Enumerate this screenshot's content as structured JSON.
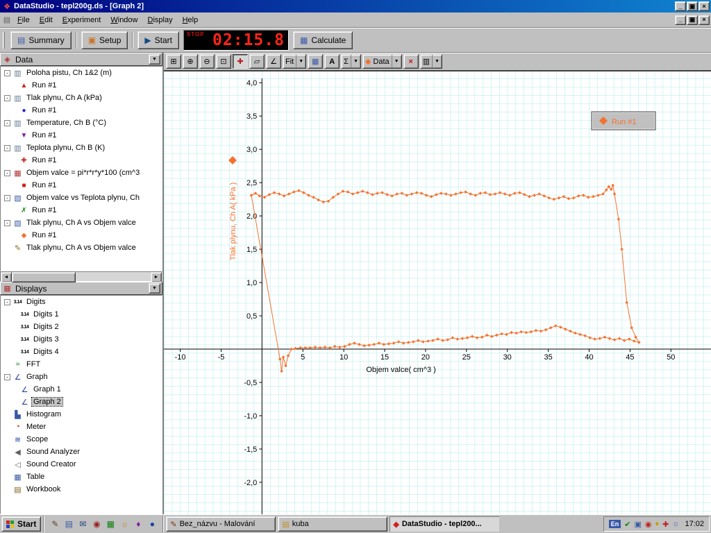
{
  "titlebar": {
    "title": "DataStudio - tepl200g.ds - [Graph 2]"
  },
  "menubar": {
    "items": [
      "File",
      "Edit",
      "Experiment",
      "Window",
      "Display",
      "Help"
    ]
  },
  "toolbar": {
    "summary_label": "Summary",
    "setup_label": "Setup",
    "start_label": "Start",
    "timer": {
      "stop_label": "STOP",
      "value": "02:15.8"
    },
    "calculate_label": "Calculate"
  },
  "graph_toolbar": {
    "buttons": [
      {
        "name": "scale-to-fit",
        "glyph": "⊞"
      },
      {
        "name": "zoom-in",
        "glyph": "⊕"
      },
      {
        "name": "zoom-out",
        "glyph": "⊖"
      },
      {
        "name": "zoom-select",
        "glyph": "⊡"
      },
      {
        "name": "smart-tool",
        "glyph": "✚",
        "color": "#b02020",
        "active": true
      },
      {
        "name": "slope-tool",
        "glyph": "▱"
      },
      {
        "name": "angle-tool",
        "glyph": "∠"
      },
      {
        "name": "fit-menu",
        "label": "Fit",
        "dropdown": true
      },
      {
        "name": "calculator-tool",
        "glyph": "▦",
        "color": "#3858a8"
      },
      {
        "name": "text-tool",
        "glyph": "A",
        "bold": true
      },
      {
        "name": "statistics-menu",
        "glyph": "Σ",
        "dropdown": true
      },
      {
        "name": "data-menu",
        "glyph": "◆",
        "color": "#f4722e",
        "label": "Data",
        "dropdown": true
      },
      {
        "name": "delete-button",
        "glyph": "×",
        "color": "#c01010",
        "bold": true
      },
      {
        "name": "graph-settings-menu",
        "glyph": "▥",
        "dropdown": true
      }
    ]
  },
  "sidebar": {
    "data_panel": {
      "title": "Data",
      "header_icon": "◈",
      "items": [
        {
          "label": "Poloha pistu, Ch 1&2 (m)",
          "glyph": "▥",
          "color": "#607890",
          "run": {
            "label": "Run #1",
            "marker": "▲",
            "marker_color": "#d02020"
          }
        },
        {
          "label": "Tlak plynu, Ch A (kPa)",
          "glyph": "▥",
          "color": "#607890",
          "run": {
            "label": "Run #1",
            "marker": "●",
            "marker_color": "#2020cc"
          }
        },
        {
          "label": "Temperature, Ch B (°C)",
          "glyph": "▥",
          "color": "#607890",
          "run": {
            "label": "Run #1",
            "marker": "▼",
            "marker_color": "#8020a0"
          }
        },
        {
          "label": "Teplota plynu, Ch B (K)",
          "glyph": "▥",
          "color": "#607890",
          "run": {
            "label": "Run #1",
            "marker": "✚",
            "marker_color": "#d02020"
          }
        },
        {
          "label": "Objem valce = pi*r*r*y*100 (cm^3",
          "glyph": "▦",
          "color": "#b03030",
          "run": {
            "label": "Run #1",
            "marker": "■",
            "marker_color": "#d02020"
          }
        },
        {
          "label": "Objem valce vs Teplota plynu, Ch",
          "glyph": "▧",
          "color": "#3858a8",
          "run": {
            "label": "Run #1",
            "marker": "✗",
            "marker_color": "#108010"
          }
        },
        {
          "label": "Tlak plynu, Ch A vs Objem valce",
          "glyph": "▧",
          "color": "#3858a8",
          "run": {
            "label": "Run #1",
            "marker": "◆",
            "marker_color": "#f4722e"
          }
        },
        {
          "label": "Tlak plynu, Ch A vs Objem valce",
          "glyph": "✎",
          "color": "#807020"
        }
      ]
    },
    "displays_panel": {
      "title": "Displays",
      "header_icon": "▦",
      "items": [
        {
          "label": "Digits",
          "glyph": "3.14",
          "small": true,
          "expand": true,
          "children": [
            {
              "label": "Digits 1",
              "glyph": "3.14",
              "small": true
            },
            {
              "label": "Digits 2",
              "glyph": "3.14",
              "small": true
            },
            {
              "label": "Digits 3",
              "glyph": "3.14",
              "small": true
            },
            {
              "label": "Digits 4",
              "glyph": "3.14",
              "small": true
            }
          ]
        },
        {
          "label": "FFT",
          "glyph": "≈",
          "color": "#108010"
        },
        {
          "label": "Graph",
          "glyph": "∠",
          "color": "#2040a0",
          "expand": true,
          "children": [
            {
              "label": "Graph 1",
              "glyph": "∠",
              "color": "#2040a0"
            },
            {
              "label": "Graph 2",
              "glyph": "∠",
              "color": "#2040a0",
              "selected": true
            }
          ]
        },
        {
          "label": "Histogram",
          "glyph": "▙",
          "color": "#3858a8"
        },
        {
          "label": "Meter",
          "glyph": "◔",
          "color": "#b02020"
        },
        {
          "label": "Scope",
          "glyph": "≋",
          "color": "#2040a0"
        },
        {
          "label": "Sound Analyzer",
          "glyph": "◀",
          "color": "#606060"
        },
        {
          "label": "Sound Creator",
          "glyph": "◁",
          "color": "#606060"
        },
        {
          "label": "Table",
          "glyph": "▦",
          "color": "#3858a8"
        },
        {
          "label": "Workbook",
          "glyph": "▤",
          "color": "#806020"
        }
      ]
    }
  },
  "chart_data": {
    "type": "scatter",
    "xlabel": "Objem valce( cm^3 )",
    "ylabel": "Tlak plynu, Ch A( kPa )",
    "xlim": [
      -12,
      54.9
    ],
    "ylim": [
      -2.48,
      4.19
    ],
    "x_ticks": [
      -10,
      -5,
      5,
      10,
      15,
      20,
      25,
      30,
      35,
      40,
      45,
      50
    ],
    "x_tick_labels": [
      "-10",
      "-5",
      "5",
      "10",
      "15",
      "20",
      "25",
      "30",
      "35",
      "40",
      "45",
      "50"
    ],
    "y_ticks": [
      4,
      3.5,
      3,
      2.5,
      2,
      1.5,
      1,
      0.5,
      -0.5,
      -1,
      -1.5,
      -2
    ],
    "y_tick_labels": [
      "4,0",
      "3,5",
      "3,0",
      "2,5",
      "2,0",
      "1,5",
      "1,0",
      "0,5",
      "-0,5",
      "-1,0",
      "-1,5",
      "-2,0"
    ],
    "grid": true,
    "grid_color": "#ade9e9",
    "legend": {
      "label": "Run #1"
    },
    "series": [
      {
        "name": "Run #1",
        "color": "#f4722e",
        "points": [
          [
            -1.3,
            2.31
          ],
          [
            -0.8,
            2.34
          ],
          [
            -0.3,
            2.3
          ],
          [
            0.3,
            2.28
          ],
          [
            0.9,
            2.32
          ],
          [
            1.5,
            2.35
          ],
          [
            2.1,
            2.33
          ],
          [
            2.7,
            2.3
          ],
          [
            3.3,
            2.33
          ],
          [
            3.9,
            2.36
          ],
          [
            4.5,
            2.38
          ],
          [
            5.1,
            2.35
          ],
          [
            5.7,
            2.31
          ],
          [
            6.3,
            2.28
          ],
          [
            6.9,
            2.24
          ],
          [
            7.5,
            2.21
          ],
          [
            8.1,
            2.22
          ],
          [
            8.7,
            2.28
          ],
          [
            9.3,
            2.33
          ],
          [
            9.9,
            2.37
          ],
          [
            10.5,
            2.36
          ],
          [
            11.1,
            2.33
          ],
          [
            11.7,
            2.35
          ],
          [
            12.3,
            2.37
          ],
          [
            12.9,
            2.35
          ],
          [
            13.5,
            2.32
          ],
          [
            14.1,
            2.34
          ],
          [
            14.7,
            2.35
          ],
          [
            15.3,
            2.32
          ],
          [
            15.9,
            2.3
          ],
          [
            16.5,
            2.33
          ],
          [
            17.1,
            2.34
          ],
          [
            17.7,
            2.31
          ],
          [
            18.3,
            2.33
          ],
          [
            18.9,
            2.35
          ],
          [
            19.5,
            2.34
          ],
          [
            20.1,
            2.31
          ],
          [
            20.7,
            2.29
          ],
          [
            21.3,
            2.32
          ],
          [
            21.9,
            2.34
          ],
          [
            22.5,
            2.33
          ],
          [
            23.1,
            2.31
          ],
          [
            23.7,
            2.33
          ],
          [
            24.3,
            2.35
          ],
          [
            24.9,
            2.36
          ],
          [
            25.5,
            2.33
          ],
          [
            26.1,
            2.31
          ],
          [
            26.7,
            2.34
          ],
          [
            27.3,
            2.35
          ],
          [
            27.9,
            2.32
          ],
          [
            28.5,
            2.33
          ],
          [
            29.1,
            2.35
          ],
          [
            29.7,
            2.33
          ],
          [
            30.3,
            2.31
          ],
          [
            30.9,
            2.34
          ],
          [
            31.5,
            2.35
          ],
          [
            32.1,
            2.32
          ],
          [
            32.7,
            2.29
          ],
          [
            33.3,
            2.31
          ],
          [
            33.9,
            2.33
          ],
          [
            34.5,
            2.3
          ],
          [
            35.1,
            2.27
          ],
          [
            35.7,
            2.25
          ],
          [
            36.3,
            2.27
          ],
          [
            36.9,
            2.29
          ],
          [
            37.5,
            2.26
          ],
          [
            38.1,
            2.27
          ],
          [
            38.7,
            2.3
          ],
          [
            39.3,
            2.31
          ],
          [
            39.9,
            2.28
          ],
          [
            40.5,
            2.29
          ],
          [
            41.1,
            2.31
          ],
          [
            41.7,
            2.33
          ],
          [
            42.1,
            2.39
          ],
          [
            42.4,
            2.44
          ],
          [
            42.7,
            2.4
          ],
          [
            42.9,
            2.46
          ],
          [
            43.1,
            2.33
          ],
          [
            43.6,
            1.95
          ],
          [
            44.0,
            1.5
          ],
          [
            44.6,
            0.7
          ],
          [
            45.2,
            0.32
          ],
          [
            45.7,
            0.18
          ],
          [
            46.1,
            0.1
          ],
          [
            45.5,
            0.12
          ],
          [
            44.9,
            0.15
          ],
          [
            44.3,
            0.13
          ],
          [
            43.7,
            0.16
          ],
          [
            43.1,
            0.14
          ],
          [
            42.5,
            0.16
          ],
          [
            41.9,
            0.18
          ],
          [
            41.3,
            0.16
          ],
          [
            40.7,
            0.15
          ],
          [
            40.1,
            0.17
          ],
          [
            39.5,
            0.2
          ],
          [
            38.9,
            0.22
          ],
          [
            38.3,
            0.24
          ],
          [
            37.7,
            0.27
          ],
          [
            37.1,
            0.3
          ],
          [
            36.5,
            0.33
          ],
          [
            35.9,
            0.35
          ],
          [
            35.3,
            0.32
          ],
          [
            34.7,
            0.29
          ],
          [
            34.1,
            0.27
          ],
          [
            33.5,
            0.28
          ],
          [
            32.9,
            0.26
          ],
          [
            32.3,
            0.25
          ],
          [
            31.7,
            0.26
          ],
          [
            31.1,
            0.24
          ],
          [
            30.5,
            0.25
          ],
          [
            29.9,
            0.22
          ],
          [
            29.3,
            0.23
          ],
          [
            28.7,
            0.21
          ],
          [
            28.1,
            0.19
          ],
          [
            27.5,
            0.21
          ],
          [
            26.9,
            0.18
          ],
          [
            26.3,
            0.17
          ],
          [
            25.7,
            0.19
          ],
          [
            25.1,
            0.17
          ],
          [
            24.5,
            0.16
          ],
          [
            23.9,
            0.15
          ],
          [
            23.3,
            0.17
          ],
          [
            22.7,
            0.14
          ],
          [
            22.1,
            0.13
          ],
          [
            21.5,
            0.15
          ],
          [
            20.9,
            0.13
          ],
          [
            20.3,
            0.12
          ],
          [
            19.7,
            0.11
          ],
          [
            19.1,
            0.13
          ],
          [
            18.5,
            0.11
          ],
          [
            17.9,
            0.1
          ],
          [
            17.3,
            0.09
          ],
          [
            16.7,
            0.11
          ],
          [
            16.1,
            0.09
          ],
          [
            15.5,
            0.08
          ],
          [
            14.9,
            0.07
          ],
          [
            14.3,
            0.09
          ],
          [
            13.7,
            0.07
          ],
          [
            13.1,
            0.06
          ],
          [
            12.5,
            0.05
          ],
          [
            11.9,
            0.07
          ],
          [
            11.3,
            0.09
          ],
          [
            10.7,
            0.07
          ],
          [
            10.1,
            0.04
          ],
          [
            9.5,
            0.03
          ],
          [
            8.9,
            0.04
          ],
          [
            8.3,
            0.02
          ],
          [
            7.7,
            0.03
          ],
          [
            7.1,
            0.02
          ],
          [
            6.5,
            0.03
          ],
          [
            5.9,
            0.02
          ],
          [
            5.3,
            0.02
          ],
          [
            4.7,
            0.02
          ],
          [
            4.1,
            0.01
          ],
          [
            3.6,
            0.0
          ],
          [
            3.2,
            -0.1
          ],
          [
            2.9,
            -0.25
          ],
          [
            2.6,
            -0.12
          ],
          [
            2.4,
            -0.33
          ],
          [
            2.2,
            -0.15
          ],
          [
            -1.3,
            2.31
          ]
        ]
      }
    ]
  },
  "taskbar": {
    "start_label": "Start",
    "quick_launch": [
      {
        "name": "shortcut-pencil",
        "glyph": "✎",
        "color": "#604020"
      },
      {
        "name": "shortcut-docs",
        "glyph": "▤",
        "color": "#3858a8"
      },
      {
        "name": "shortcut-mail",
        "glyph": "✉",
        "color": "#204080"
      },
      {
        "name": "shortcut-cd",
        "glyph": "◉",
        "color": "#a02020"
      },
      {
        "name": "shortcut-grid",
        "glyph": "▦",
        "color": "#108010"
      },
      {
        "name": "shortcut-sun",
        "glyph": "☼",
        "color": "#c08000"
      },
      {
        "name": "shortcut-diamond",
        "glyph": "♦",
        "color": "#8020a0"
      },
      {
        "name": "shortcut-globe",
        "glyph": "●",
        "color": "#2040a0"
      }
    ],
    "tasks": [
      {
        "name": "task-paint",
        "icon": "✎",
        "icon_color": "#803010",
        "label": "Bez_názvu - Malování"
      },
      {
        "name": "task-kuba",
        "icon": "▤",
        "icon_color": "#c09020",
        "label": "kuba"
      },
      {
        "name": "task-datastudio",
        "icon": "◆",
        "icon_color": "#d02020",
        "label": "DataStudio - tepl200...",
        "active": true
      }
    ],
    "tray": {
      "lang": "En",
      "icons": [
        {
          "name": "tray-check",
          "glyph": "✔",
          "color": "#108010"
        },
        {
          "name": "tray-display",
          "glyph": "▣",
          "color": "#3858a8"
        },
        {
          "name": "tray-record",
          "glyph": "◉",
          "color": "#c02020"
        },
        {
          "name": "tray-diamond",
          "glyph": "♦",
          "color": "#c0a000"
        },
        {
          "name": "tray-plus",
          "glyph": "✚",
          "color": "#c02020"
        },
        {
          "name": "tray-sun",
          "glyph": "☼",
          "color": "#4060c0"
        }
      ],
      "time": "17:02"
    }
  }
}
